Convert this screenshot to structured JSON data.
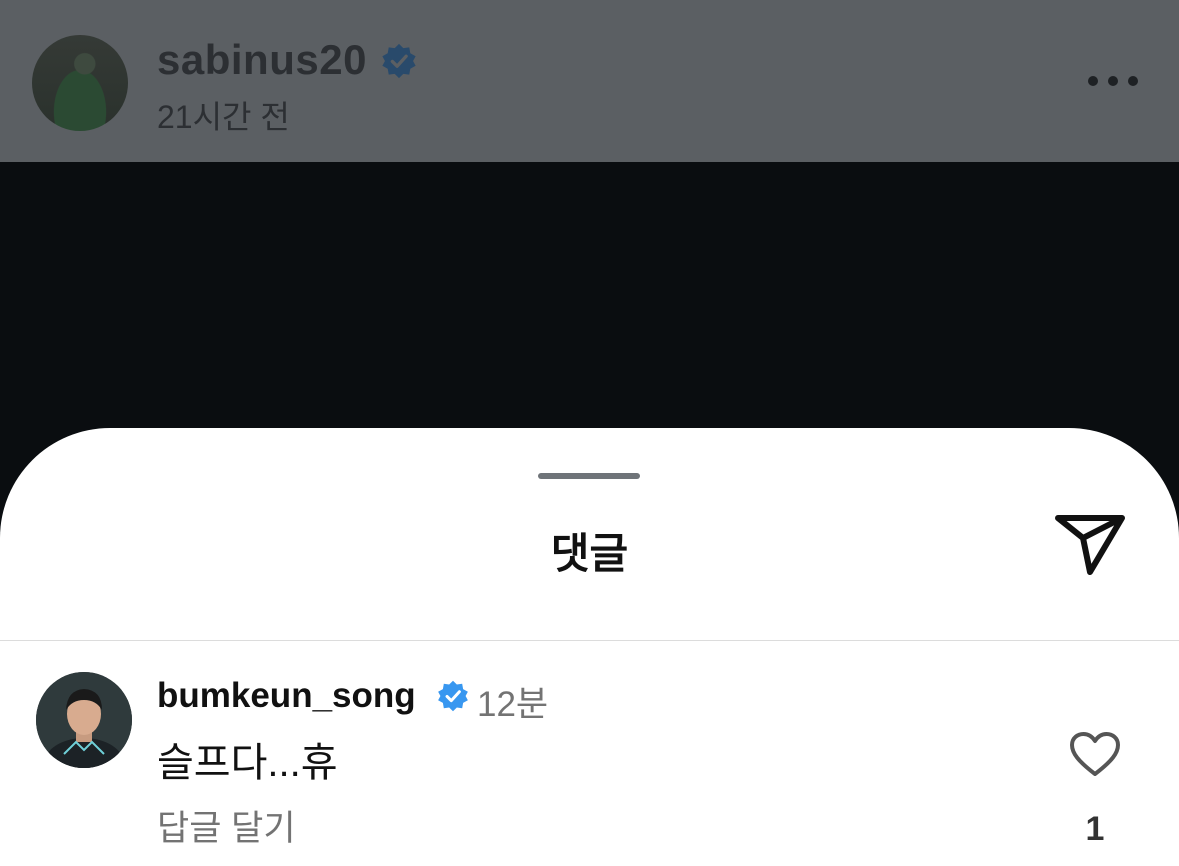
{
  "post": {
    "username": "sabinus20",
    "time": "21시간 전",
    "verified_icon": "verified-badge-icon",
    "more_icon": "more-horizontal-icon"
  },
  "comments_sheet": {
    "title": "댓글",
    "share_icon": "send-icon"
  },
  "comments": [
    {
      "username": "bumkeun_song",
      "time": "12분",
      "text": "슬프다...휴",
      "reply_label": "답글 달기",
      "like_count": "1",
      "like_icon": "heart-outline-icon"
    }
  ],
  "colors": {
    "verified_blue": "#3897f0",
    "header_overlay": "#5b5f63",
    "muted_text": "#737373"
  }
}
